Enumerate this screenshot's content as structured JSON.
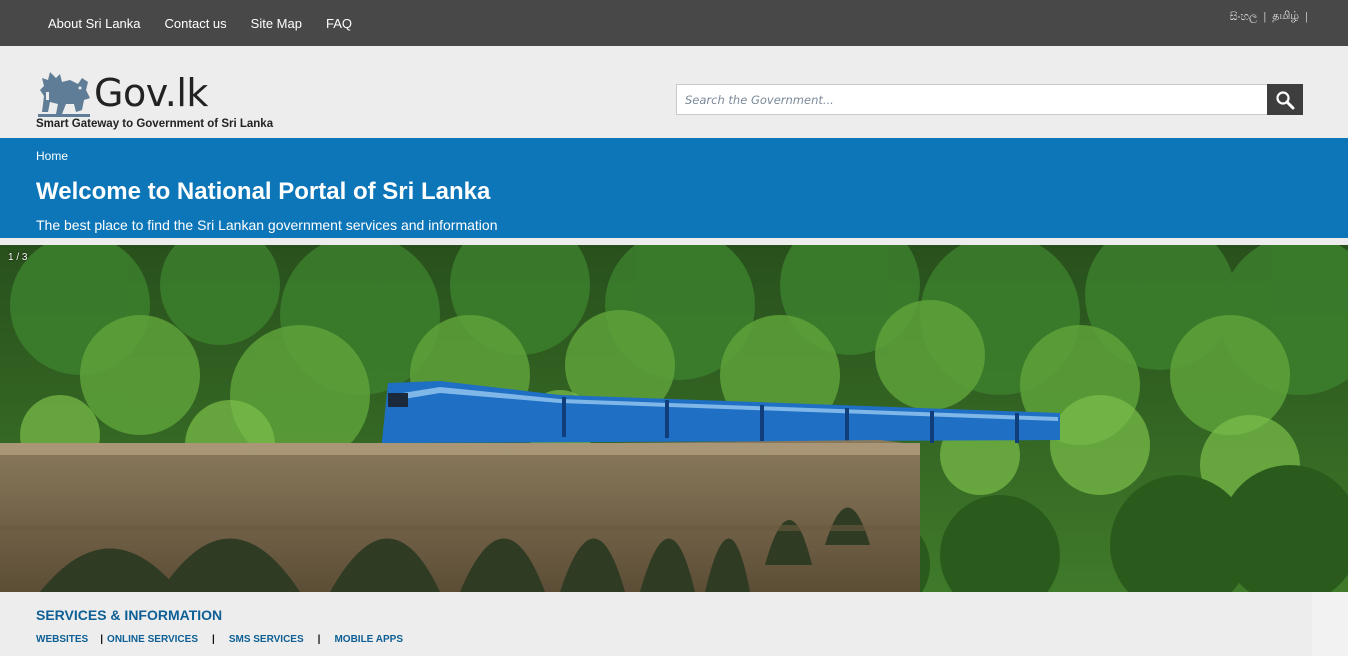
{
  "topnav": {
    "items": [
      "About Sri Lanka",
      "Contact us",
      "Site Map",
      "FAQ"
    ]
  },
  "languages": [
    "සිංහල",
    "தமிழ்"
  ],
  "logo": {
    "wordmark": "Gov.lk",
    "tagline": "Smart Gateway to Government of Sri Lanka"
  },
  "search": {
    "placeholder": "Search the Government...",
    "value": "",
    "icon": "search-icon"
  },
  "breadcrumb": "Home",
  "banner": {
    "title": "Welcome to National Portal of Sri Lanka",
    "subtitle": "The best place to find the Sri Lankan government services and information"
  },
  "slider": {
    "counter": "1 / 3"
  },
  "services": {
    "heading": "SERVICES & INFORMATION",
    "links": [
      "WEBSITES",
      "ONLINE SERVICES",
      "SMS SERVICES",
      "MOBILE APPS"
    ]
  },
  "colors": {
    "topbar": "#484848",
    "header": "#ededed",
    "banner": "#0d76b8",
    "services_heading": "#0d5f95"
  }
}
